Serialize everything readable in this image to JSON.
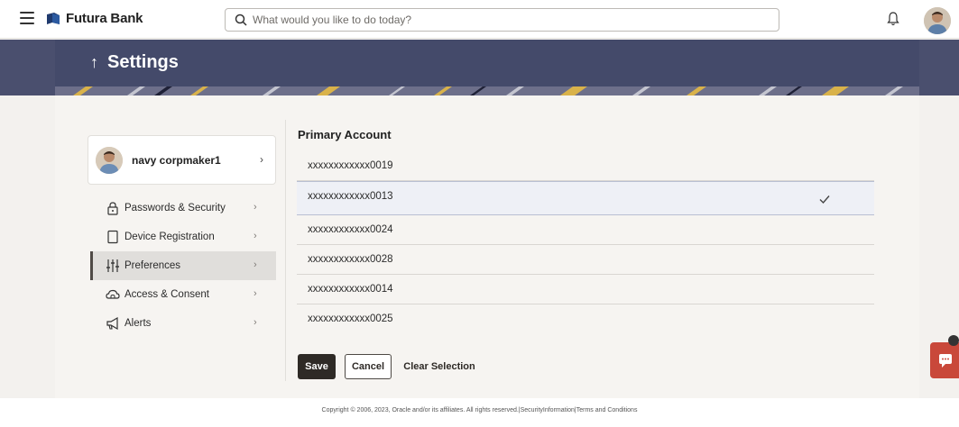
{
  "app": {
    "brand": "Futura Bank",
    "search_placeholder": "What would you like to do today?"
  },
  "page": {
    "title": "Settings"
  },
  "profile": {
    "name": "navy corpmaker1"
  },
  "nav": {
    "items": [
      {
        "label": "Passwords & Security",
        "icon": "lock-icon"
      },
      {
        "label": "Device Registration",
        "icon": "device-icon"
      },
      {
        "label": "Preferences",
        "icon": "sliders-icon",
        "active": true
      },
      {
        "label": "Access & Consent",
        "icon": "cloud-access-icon"
      },
      {
        "label": "Alerts",
        "icon": "megaphone-icon"
      }
    ]
  },
  "primary_account": {
    "title": "Primary Account",
    "accounts": [
      "xxxxxxxxxxxx0019",
      "xxxxxxxxxxxx0013",
      "xxxxxxxxxxxx0024",
      "xxxxxxxxxxxx0028",
      "xxxxxxxxxxxx0014",
      "xxxxxxxxxxxx0025"
    ],
    "selected": "xxxxxxxxxxxx0013"
  },
  "actions": {
    "save": "Save",
    "cancel": "Cancel",
    "clear": "Clear Selection"
  },
  "footer": {
    "text": "Copyright © 2006, 2023, Oracle and/or its affiliates. All rights reserved.|SecurityInformation|Terms and Conditions"
  },
  "colors": {
    "banner": "#444a6a",
    "primary_button": "#2e2a26",
    "chat": "#c9483a"
  }
}
